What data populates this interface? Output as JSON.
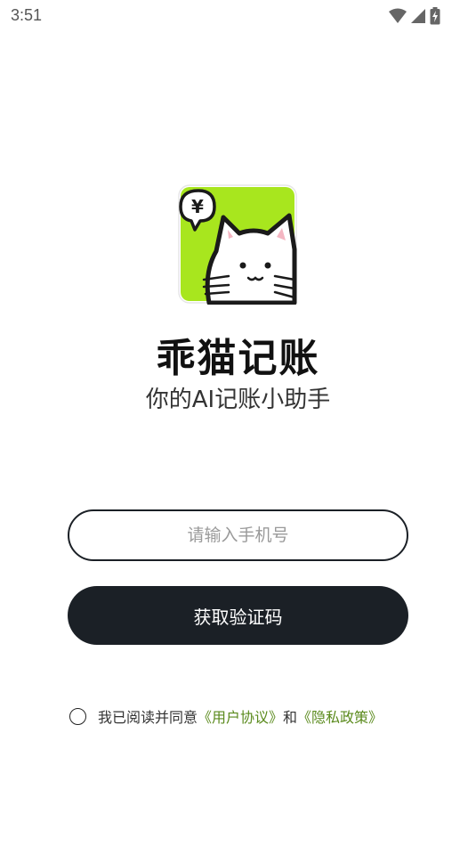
{
  "status_bar": {
    "time": "3:51",
    "icons": [
      "wifi-icon",
      "signal-icon",
      "battery-charging-icon"
    ]
  },
  "app": {
    "logo_icon": "cat-yuan-logo-icon",
    "logo_symbol": "¥",
    "name": "乖猫记账",
    "slogan": "你的AI记账小助手"
  },
  "form": {
    "phone_placeholder": "请输入手机号",
    "phone_value": "",
    "submit_label": "获取验证码"
  },
  "agreement": {
    "checked": false,
    "prefix": "我已阅读并同意",
    "user_agreement": "《用户协议》",
    "conjunction": "和",
    "privacy_policy": "《隐私政策》"
  },
  "colors": {
    "brand_green": "#a8e61e",
    "button_dark": "#1b2026",
    "link_green": "#5a8a1c"
  }
}
